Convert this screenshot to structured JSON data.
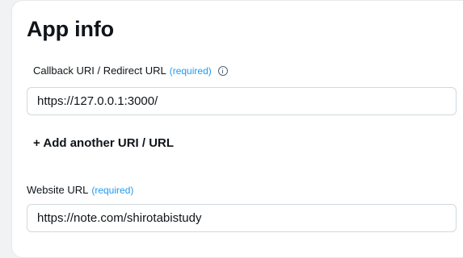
{
  "section": {
    "title": "App info"
  },
  "callback": {
    "label": "Callback URI / Redirect URL",
    "required": "(required)",
    "value": "https://127.0.0.1:3000/"
  },
  "add_another": {
    "label": "+ Add another URI / URL"
  },
  "website": {
    "label": "Website URL",
    "required": "(required)",
    "value": "https://note.com/shirotabistudy"
  },
  "colors": {
    "required": "#1d9bf0",
    "text": "#0f1419",
    "border": "#cfd9de",
    "background": "#f0f2f4"
  },
  "icons": [
    "info-icon"
  ]
}
